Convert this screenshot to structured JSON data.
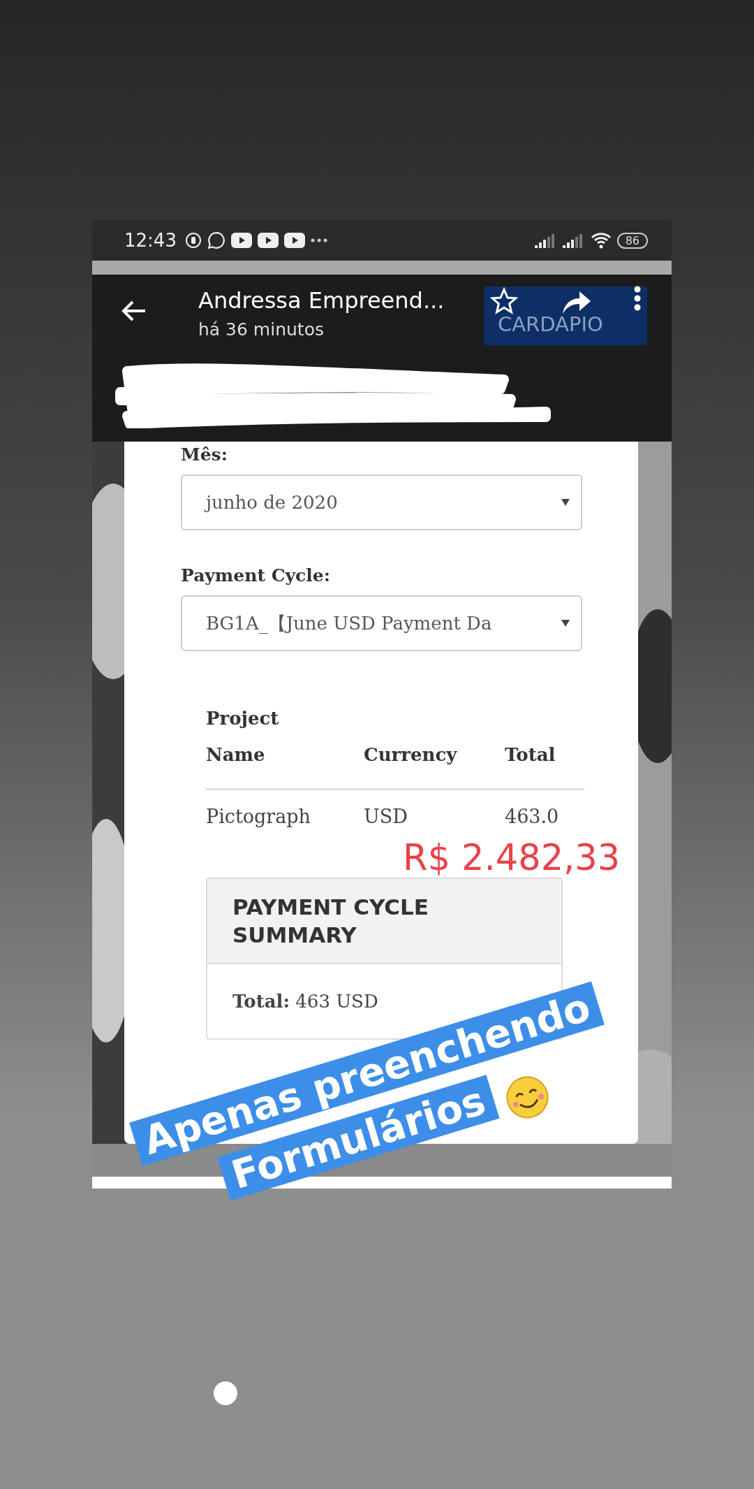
{
  "status_bar": {
    "time": "12:43",
    "battery": "86"
  },
  "header": {
    "title": "Andressa Empreend...",
    "subtitle": "há 36 minutos",
    "button": "CARDAPIO"
  },
  "form": {
    "fields": [
      {
        "label": "Mês:",
        "value": "junho de 2020"
      },
      {
        "label": "Payment Cycle:",
        "value": "BG1A_【June USD Payment Da"
      }
    ]
  },
  "table": {
    "columns": [
      "Project Name",
      "Currency",
      "Total"
    ],
    "rows": [
      [
        "Pictograph",
        "USD",
        "463.0"
      ]
    ]
  },
  "overlay_amount": "R$ 2.482,33",
  "summary": {
    "title": "PAYMENT CYCLE SUMMARY",
    "total": "**Total:** 463 USD"
  },
  "sticker": {
    "text": "Apenas preenchendo Formulários"
  }
}
